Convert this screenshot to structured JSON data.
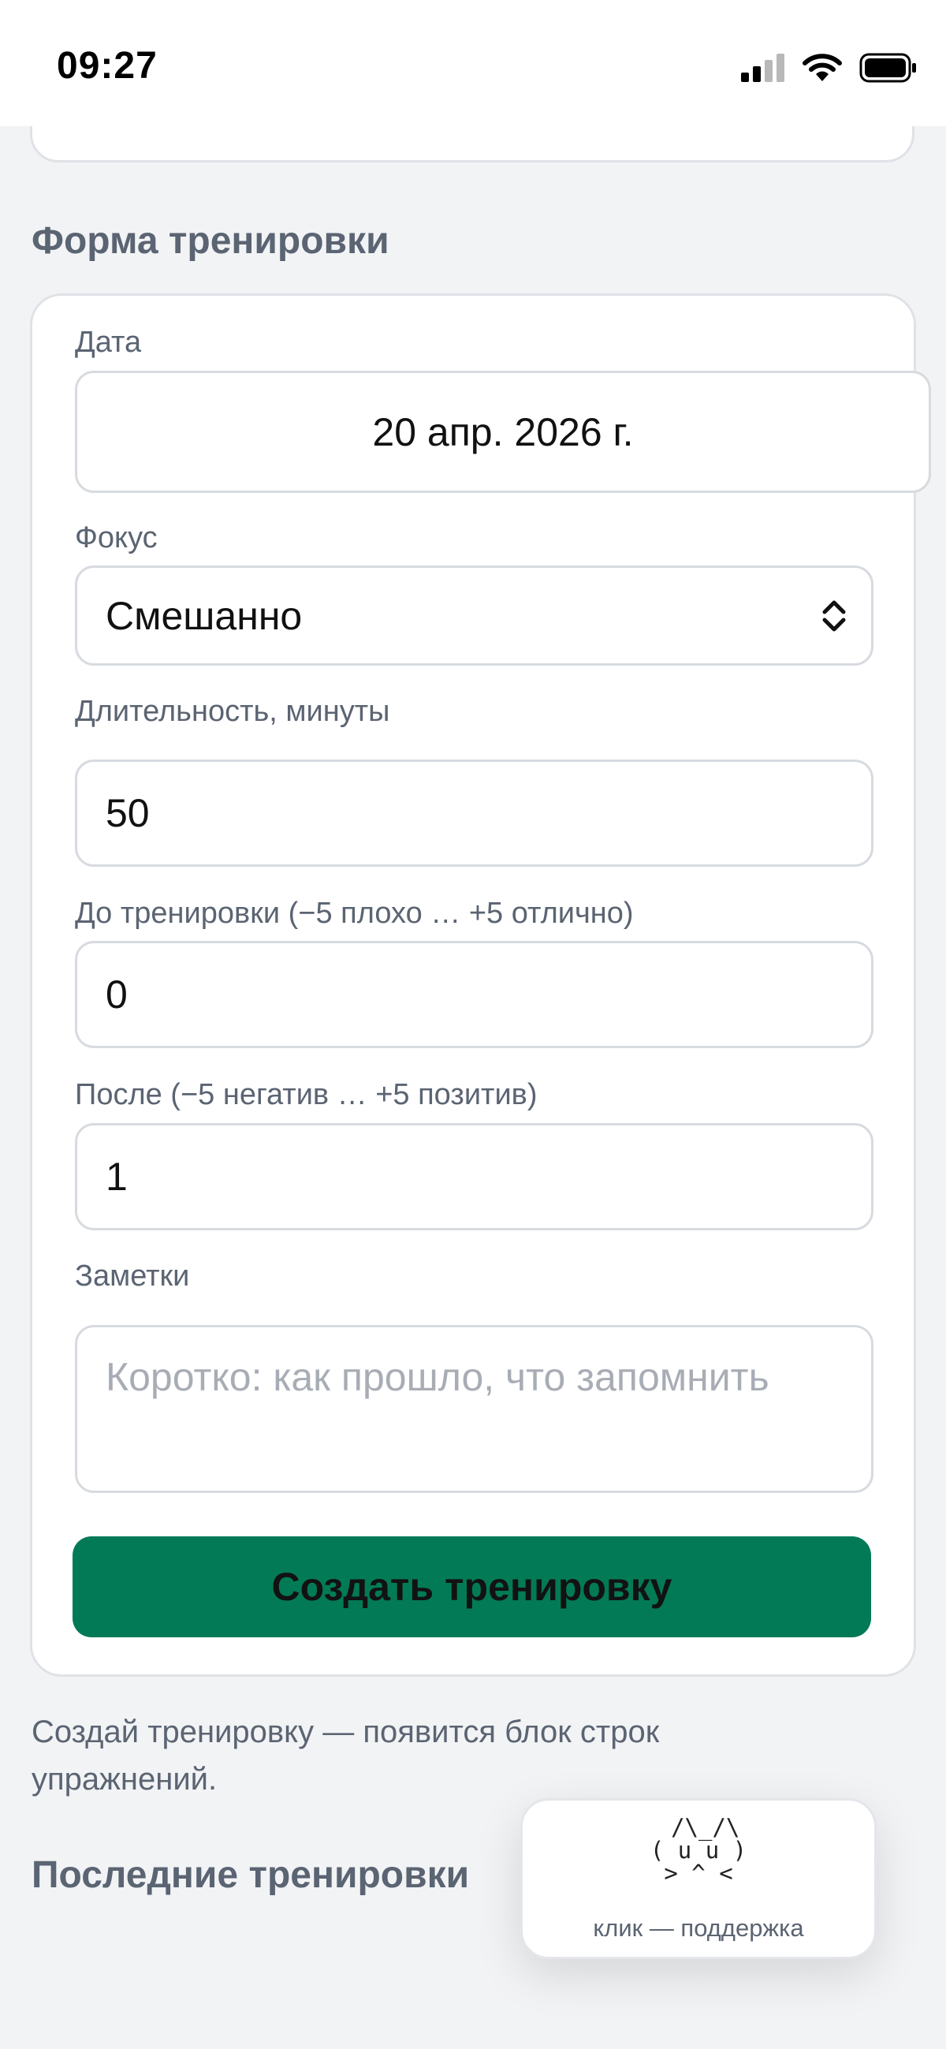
{
  "status_bar": {
    "time": "09:27",
    "signal_icon": "cellular-signal-icon",
    "wifi_icon": "wifi-icon",
    "battery_icon": "battery-icon"
  },
  "form_section": {
    "title": "Форма тренировки",
    "date": {
      "label": "Дата",
      "value": "20 апр. 2026 г."
    },
    "focus": {
      "label": "Фокус",
      "value": "Смешанно",
      "icon": "chevron-up-down-icon"
    },
    "duration": {
      "label": "Длительность, минуты",
      "value": "50"
    },
    "before": {
      "label": "До тренировки (−5 плохо … +5 отлично)",
      "value": "0"
    },
    "after": {
      "label": "После (−5 негатив … +5 позитив)",
      "value": "1"
    },
    "notes": {
      "label": "Заметки",
      "placeholder": "Коротко: как прошло, что запомнить"
    },
    "submit_label": "Создать тренировку"
  },
  "hint": "Создай тренировку — появится блок строк упражнений.",
  "recent_section": {
    "title": "Последние тренировки"
  },
  "support_widget": {
    "art": " /\\_/\\\n( u u )\n > ^ < ",
    "caption": "клик — поддержка"
  },
  "colors": {
    "accent": "#037a56",
    "background": "#f2f3f5",
    "muted_text": "#5b6472"
  }
}
